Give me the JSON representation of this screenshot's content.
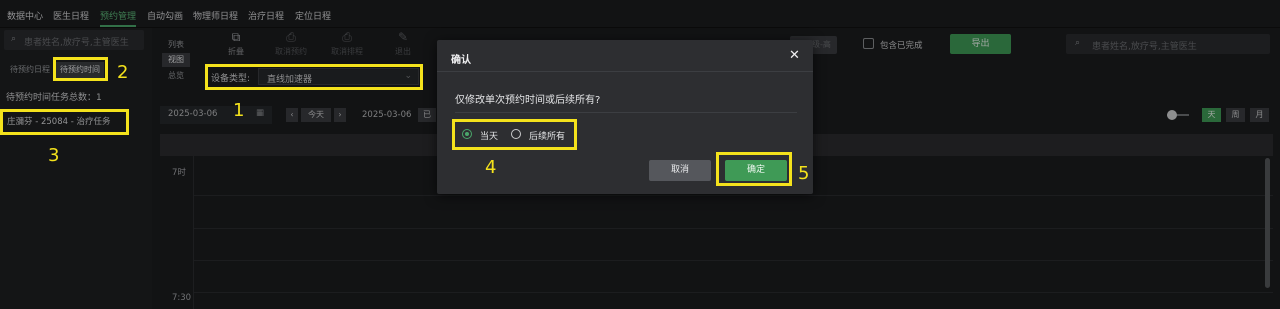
{
  "nav": {
    "items": [
      "数据中心",
      "医生日程",
      "预约管理",
      "自动勾画",
      "物理师日程",
      "治疗日程",
      "定位日程"
    ],
    "active_index": 2
  },
  "left": {
    "search_placeholder": "患者姓名,放疗号,主管医生",
    "tabs": [
      "待预约日程",
      "待预约时间"
    ],
    "selected_tab": 1,
    "total_label": "待预约时间任务总数：1",
    "task_row": "庄瀰芬 - 25084 - 治疗任务"
  },
  "view_switch": [
    "列表",
    "视图",
    "总览"
  ],
  "toolbar": {
    "buttons": [
      {
        "label": "折叠",
        "icon": "collapse-icon",
        "enabled": true
      },
      {
        "label": "取消预约",
        "icon": "printer-icon",
        "enabled": false
      },
      {
        "label": "取消排程",
        "icon": "printer-icon",
        "enabled": false
      },
      {
        "label": "退出",
        "icon": "edit-icon",
        "enabled": false
      }
    ],
    "device_label": "设备类型:",
    "device_value": "直线加速器",
    "priority_box": "优先级-高",
    "include_completed": "包含已完成",
    "export": "导出",
    "search_placeholder": "患者姓名,放疗号,主管医生"
  },
  "datebar": {
    "date": "2025-03-06",
    "today": "今天",
    "current_date": "2025-03-06",
    "partial_tag": "已",
    "views": [
      "天",
      "周",
      "月"
    ],
    "active_view": 0
  },
  "calendar": {
    "time_labels": [
      "7时",
      "7:30"
    ]
  },
  "dialog": {
    "title": "确认",
    "close": "✕",
    "question": "仅修改单次预约时间或后续所有?",
    "options": [
      "当天",
      "后续所有"
    ],
    "selected_option": 0,
    "cancel": "取消",
    "confirm": "确定"
  },
  "annotations": [
    "1",
    "2",
    "3",
    "4",
    "5"
  ],
  "colors": {
    "accent_green": "#3f9a56",
    "annotation_yellow": "#f4e21c",
    "background": "#1b1c1e"
  }
}
